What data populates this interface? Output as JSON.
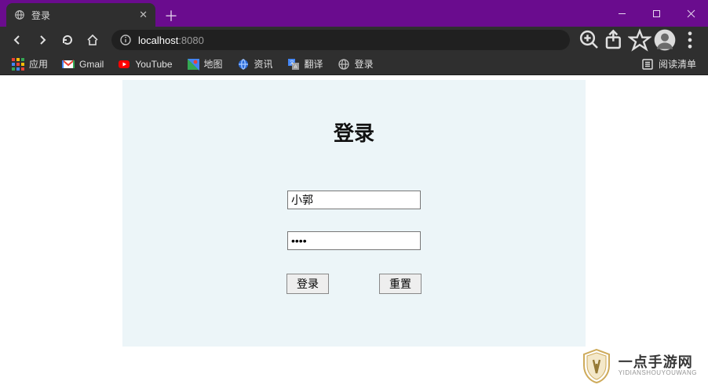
{
  "window": {
    "tab_title": "登录",
    "url_host": "localhost",
    "url_port": ":8080"
  },
  "bookmarks": {
    "apps": "应用",
    "gmail": "Gmail",
    "youtube": "YouTube",
    "maps": "地图",
    "news": "资讯",
    "translate": "翻译",
    "login": "登录",
    "reading_list": "阅读清单"
  },
  "page": {
    "heading": "登录",
    "username_value": "小郭",
    "password_value": "••••",
    "submit_label": "登录",
    "reset_label": "重置"
  },
  "watermark": {
    "cn": "一点手游网",
    "en": "YIDIANSHOUYOUWANG"
  }
}
